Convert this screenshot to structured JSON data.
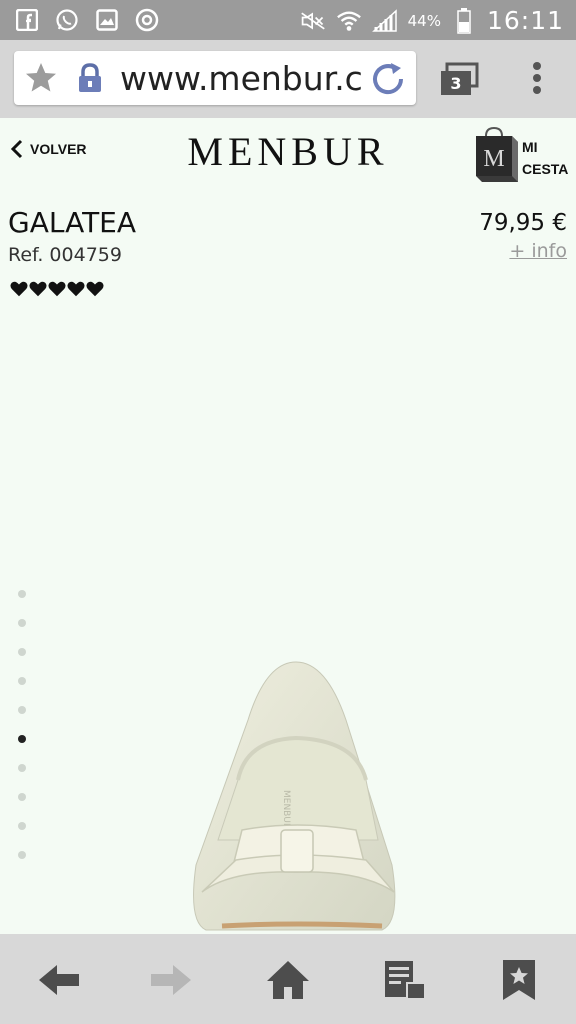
{
  "status_bar": {
    "icons": [
      "facebook-icon",
      "whatsapp-icon",
      "gallery-icon",
      "app-icon",
      "mute-icon",
      "wifi-icon",
      "signal-icon",
      "battery-icon"
    ],
    "battery": "44%",
    "time": "16:11"
  },
  "browser": {
    "url": "www.menbur.c",
    "tab_count": "3",
    "icons": [
      "star-icon",
      "lock-icon",
      "reload-icon",
      "tabs-icon",
      "overflow-menu-icon"
    ]
  },
  "header": {
    "back_label": "VOLVER",
    "brand": "MENBUR",
    "cart_line1": "MI",
    "cart_line2": "CESTA"
  },
  "product": {
    "name": "GALATEA",
    "ref": "Ref. 004759",
    "price": "79,95 €",
    "more_info": "+ info",
    "rating": 5,
    "rating_max": 5
  },
  "gallery": {
    "image_count": 10,
    "active_index": 5
  },
  "bottom_nav": {
    "items": [
      "back-arrow-icon",
      "forward-arrow-icon",
      "home-icon",
      "reading-list-icon",
      "bookmark-icon"
    ]
  },
  "colors": {
    "status_bar": "#9b9b9b",
    "toolbar": "#d6d6d6",
    "page_background": "#f4fbf4",
    "link_gray": "#9a9a9a"
  }
}
